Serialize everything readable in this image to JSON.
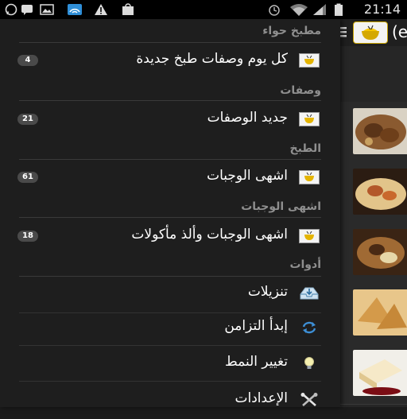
{
  "statusbar": {
    "time": "21:14"
  },
  "actionbar": {
    "title_fragment": "(e"
  },
  "drawer": {
    "sections": [
      {
        "header": "مطبخ حواء",
        "items": [
          {
            "label": "كل يوم وصفات طبخ جديدة",
            "badge": "4",
            "icon": "folder-mail-icon"
          }
        ]
      },
      {
        "header": "وصفات",
        "items": [
          {
            "label": "جديد الوصفات",
            "badge": "21",
            "icon": "folder-mail-icon"
          }
        ]
      },
      {
        "header": "الطبخ",
        "items": [
          {
            "label": "اشهى الوجبات",
            "badge": "61",
            "icon": "folder-mail-icon"
          }
        ]
      },
      {
        "header": "اشهى الوجبات",
        "items": [
          {
            "label": "اشهى الوجبات وألذ مأكولات",
            "badge": "18",
            "icon": "folder-mail-icon"
          }
        ]
      },
      {
        "header": "أدوات",
        "items": [
          {
            "label": "تنزيلات",
            "icon": "download-tray-icon"
          },
          {
            "label": "إبدأ التزامن",
            "icon": "sync-icon"
          },
          {
            "label": "تغيير النمط",
            "icon": "lightbulb-icon"
          },
          {
            "label": "الإعدادات",
            "icon": "settings-tools-icon"
          }
        ]
      }
    ]
  },
  "colors": {
    "drawer_bg": "#1e1e1e",
    "section_header": "#8f8f8f",
    "badge_bg": "#4a4a4a",
    "accent": "#f6c700"
  }
}
